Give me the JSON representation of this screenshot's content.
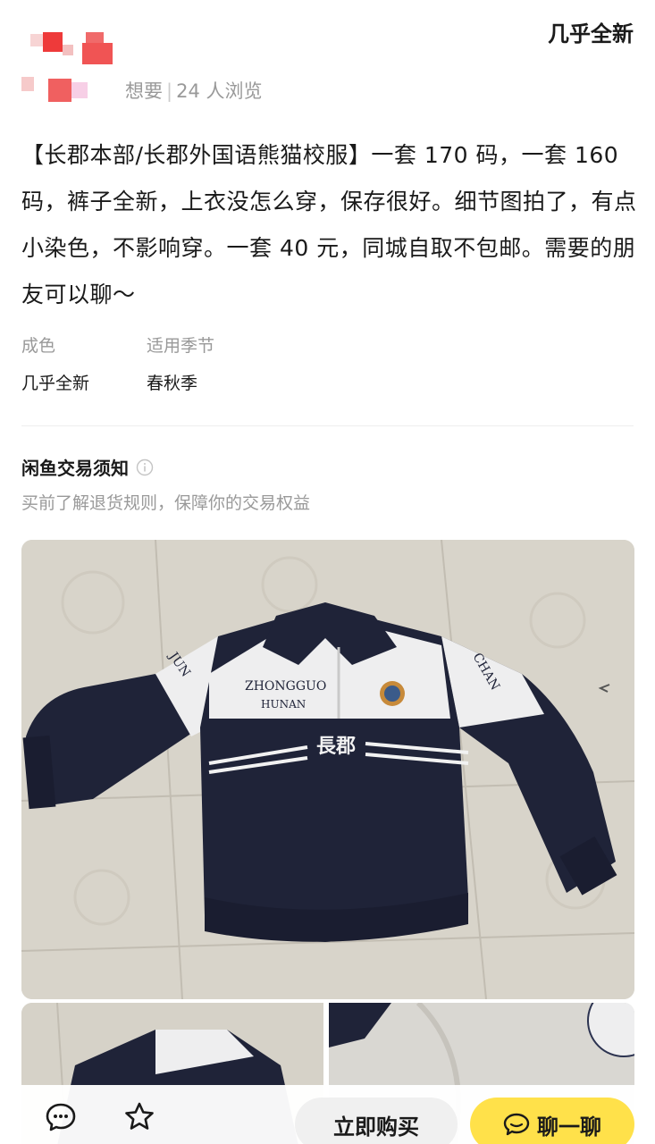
{
  "header": {
    "condition_tag": "几乎全新",
    "want_text": "想要",
    "views_text": "24 人浏览"
  },
  "description": "【长郡本部/长郡外国语熊猫校服】一套 170 码，一套 160 码，裤子全新，上衣没怎么穿，保存很好。细节图拍了，有点小染色，不影响穿。一套 40 元，同城自取不包邮。需要的朋友可以聊～",
  "attributes": [
    {
      "label": "成色",
      "value": "几乎全新"
    },
    {
      "label": "适用季节",
      "value": "春秋季"
    }
  ],
  "notice": {
    "title": "闲鱼交易须知",
    "subtitle": "买前了解退货规则，保障你的交易权益"
  },
  "photos": {
    "main_jacket_text": {
      "zhongguo": "ZHONGGUO",
      "hunan": "HUNAN",
      "school": "長郡",
      "sleeve_left": "JUN",
      "sleeve_right": "CHAN"
    }
  },
  "bottom_bar": {
    "icons": [
      "comment-icon",
      "star-icon"
    ],
    "buy_label": "立即购买",
    "chat_label": "聊一聊"
  },
  "colors": {
    "accent_yellow": "#ffe14a",
    "jacket_navy": "#1f2338",
    "floor": "#d9d5cc"
  }
}
